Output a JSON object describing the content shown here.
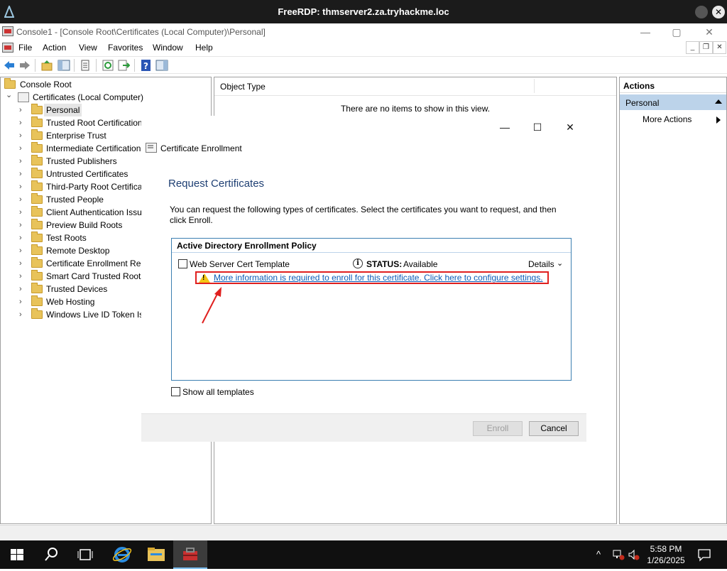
{
  "rdp": {
    "title": "FreeRDP: thmserver2.za.tryhackme.loc",
    "close_glyph": "✕"
  },
  "window": {
    "title": "Console1 - [Console Root\\Certificates (Local Computer)\\Personal]",
    "minimize": "—",
    "maximize": "▢",
    "close": "✕"
  },
  "menu": {
    "items": [
      "File",
      "Action",
      "View",
      "Favorites",
      "Window",
      "Help"
    ],
    "child_minimize": "_",
    "child_restore": "❐",
    "child_close": "✕"
  },
  "toolbar": {
    "icons": [
      "back-icon",
      "forward-icon",
      "up-folder-icon",
      "show-hide-tree-icon",
      "properties-icon",
      "refresh-icon",
      "export-list-icon",
      "help-icon",
      "show-hide-action-pane-icon"
    ]
  },
  "tree": {
    "root": "Console Root",
    "certificates": "Certificates (Local Computer)",
    "chevron_open": "⌄",
    "chevron_closed": "›",
    "items": [
      "Personal",
      "Trusted Root Certification",
      "Enterprise Trust",
      "Intermediate Certification",
      "Trusted Publishers",
      "Untrusted Certificates",
      "Third-Party Root Certifica",
      "Trusted People",
      "Client Authentication Issu",
      "Preview Build Roots",
      "Test Roots",
      "Remote Desktop",
      "Certificate Enrollment Rec",
      "Smart Card Trusted Roots",
      "Trusted Devices",
      "Web Hosting",
      "Windows Live ID Token Is"
    ]
  },
  "list": {
    "column": "Object Type",
    "empty_message": "There are no items to show in this view."
  },
  "actions": {
    "header": "Actions",
    "section": "Personal",
    "more": "More Actions"
  },
  "dialog": {
    "title": "Certificate Enrollment",
    "minimize": "—",
    "maximize": "☐",
    "close": "✕",
    "heading": "Request Certificates",
    "instructions": "You can request the following types of certificates. Select the certificates you want to request, and then click Enroll.",
    "policy": "Active Directory Enrollment Policy",
    "template": "Web Server Cert Template",
    "status_icon": "i",
    "status_label": "STATUS:",
    "status_value": "Available",
    "details": "Details",
    "details_chevron": "⌄",
    "warning_mark": "!",
    "warning_link": "More information is required to enroll for this certificate. Click here to configure settings.",
    "show_all": "Show all templates",
    "enroll": "Enroll",
    "cancel": "Cancel"
  },
  "taskbar": {
    "time": "5:58 PM",
    "date": "1/26/2025",
    "tray_up": "^"
  },
  "colors": {
    "accent": "#0b5cb8",
    "warning_border": "#e0201f",
    "selection": "#bcd3ea"
  }
}
